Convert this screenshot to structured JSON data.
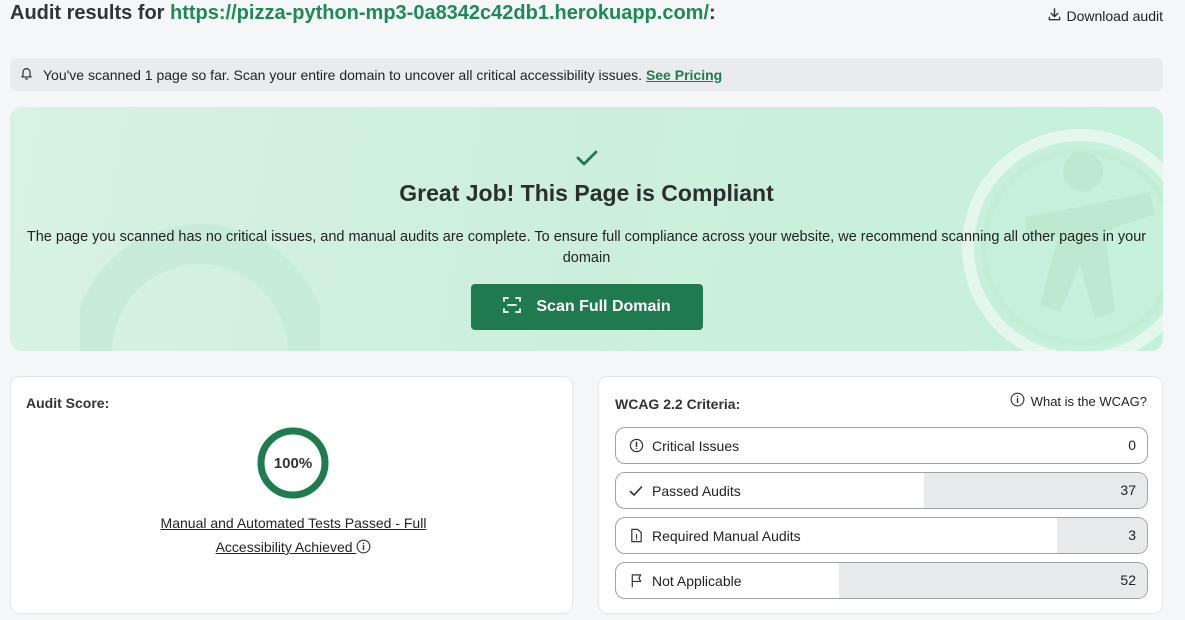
{
  "header": {
    "title_prefix": "Audit results for ",
    "url": "https://pizza-python-mp3-0a8342c42db1.herokuapp.com/",
    "title_suffix": ":",
    "download_label": "Download audit"
  },
  "notice": {
    "text": "You've scanned 1 page so far. Scan your entire domain to uncover all critical accessibility issues. ",
    "link_label": "See Pricing"
  },
  "success": {
    "heading": "Great Job! This Page is Compliant",
    "description": "The page you scanned has no critical issues, and manual audits are complete. To ensure full compliance across your website, we recommend scanning all other pages in your domain",
    "button_label": "Scan Full Domain"
  },
  "score": {
    "title": "Audit Score:",
    "percent_label": "100%",
    "percent_value": 100,
    "summary": "Manual and Automated Tests Passed - Full Accessibility Achieved "
  },
  "wcag": {
    "title": "WCAG 2.2 Criteria:",
    "help_label": "What is the WCAG?",
    "rows": [
      {
        "label": "Critical Issues",
        "count": "0",
        "icon": "alert-circle-icon",
        "fill": 0
      },
      {
        "label": "Passed Audits",
        "count": "37",
        "icon": "check-icon",
        "fill": 0.42
      },
      {
        "label": "Required Manual Audits",
        "count": "3",
        "icon": "document-icon",
        "fill": 0.17
      },
      {
        "label": "Not Applicable",
        "count": "52",
        "icon": "flag-icon",
        "fill": 0.58
      }
    ]
  },
  "colors": {
    "accent": "#1f7a4f",
    "url": "#1e8a56",
    "ring": "#1e7c4e"
  }
}
